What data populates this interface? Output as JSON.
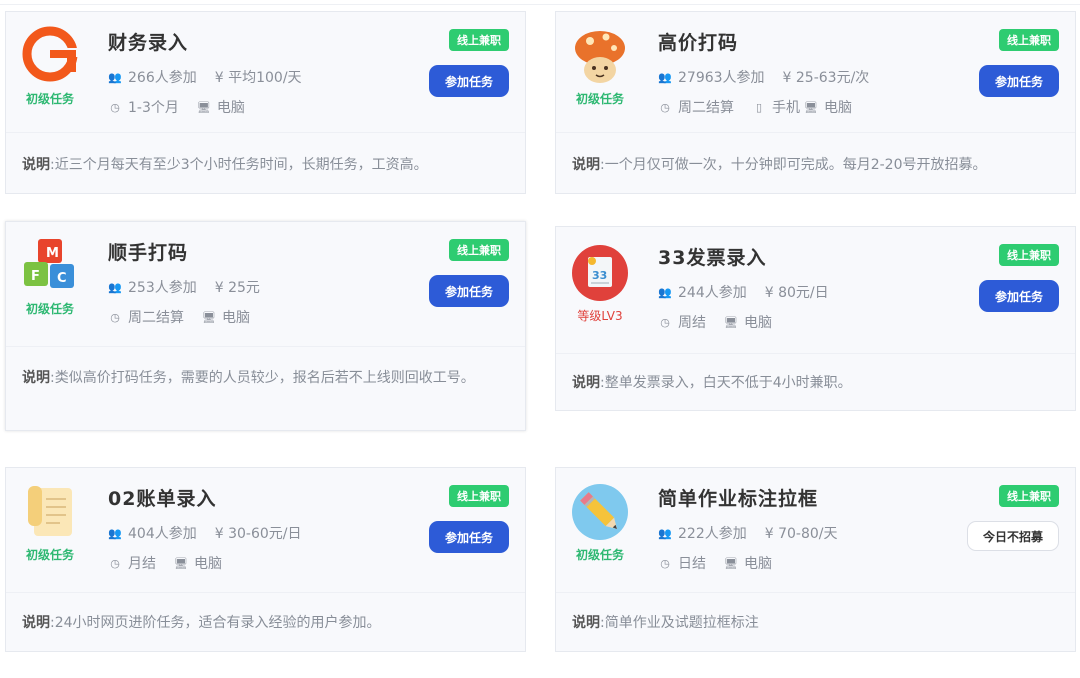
{
  "cards": [
    {
      "title": "财务录入",
      "level": "初级任务",
      "participants": "266人参加",
      "pay": "¥ 平均100/天",
      "duration": "1-3个月",
      "devices": [
        "电脑"
      ],
      "tag": "线上兼职",
      "button": "参加任务",
      "desc_label": "说明",
      "desc": ":近三个月每天有至少3个小时任务时间，长期任务，工资高。"
    },
    {
      "title": "高价打码",
      "level": "初级任务",
      "participants": "27963人参加",
      "pay": "¥ 25-63元/次",
      "duration": "周二结算",
      "devices": [
        "手机",
        "电脑"
      ],
      "tag": "线上兼职",
      "button": "参加任务",
      "desc_label": "说明",
      "desc": ":一个月仅可做一次，十分钟即可完成。每月2-20号开放招募。"
    },
    {
      "title": "顺手打码",
      "level": "初级任务",
      "participants": "253人参加",
      "pay": "¥ 25元",
      "duration": "周二结算",
      "devices": [
        "电脑"
      ],
      "tag": "线上兼职",
      "button": "参加任务",
      "desc_label": "说明",
      "desc": ":类似高价打码任务，需要的人员较少，报名后若不上线则回收工号。"
    },
    {
      "title": "33发票录入",
      "level": "等级LV3",
      "participants": "244人参加",
      "pay": "¥ 80元/日",
      "duration": "周结",
      "devices": [
        "电脑"
      ],
      "tag": "线上兼职",
      "button": "参加任务",
      "desc_label": "说明",
      "desc": ":整单发票录入，白天不低于4小时兼职。"
    },
    {
      "title": "02账单录入",
      "level": "初级任务",
      "participants": "404人参加",
      "pay": "¥ 30-60元/日",
      "duration": "月结",
      "devices": [
        "电脑"
      ],
      "tag": "线上兼职",
      "button": "参加任务",
      "desc_label": "说明",
      "desc": ":24小时网页进阶任务，适合有录入经验的用户参加。"
    },
    {
      "title": "简单作业标注拉框",
      "level": "初级任务",
      "participants": "222人参加",
      "pay": "¥ 70-80/天",
      "duration": "日结",
      "devices": [
        "电脑"
      ],
      "tag": "线上兼职",
      "button": "今日不招募",
      "desc_label": "说明",
      "desc": ":简单作业及试题拉框标注"
    }
  ],
  "colors": {
    "accent_blue": "#2d5bd7",
    "tag_green": "#2ecc71",
    "level_green": "#2eb872",
    "level_red": "#e0413b"
  },
  "icons": [
    "user-icon",
    "clock-icon",
    "monitor-icon",
    "phone-icon"
  ]
}
